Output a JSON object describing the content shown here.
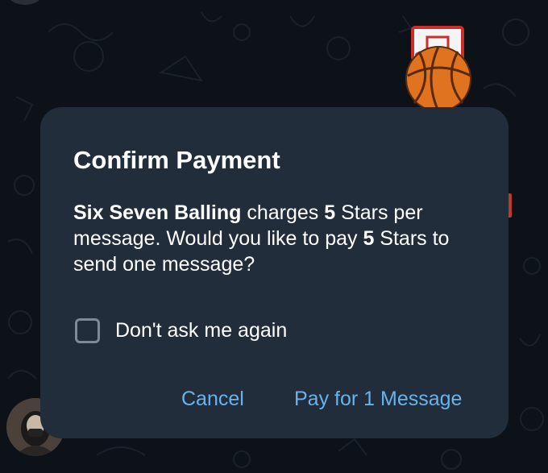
{
  "dialog": {
    "title": "Confirm Payment",
    "message": {
      "bot_name": "Six Seven Balling",
      "part1": " charges ",
      "stars_per_message": "5",
      "part2": " Stars per message. Would you like to pay ",
      "stars_to_pay": "5",
      "part3": " Stars to send one message?"
    },
    "checkbox": {
      "label": "Don't ask me again",
      "checked": false
    },
    "buttons": {
      "cancel": "Cancel",
      "confirm": "Pay for 1 Message"
    }
  },
  "colors": {
    "background": "#0c1218",
    "dialog_background": "#212d3b",
    "accent": "#68b3ec",
    "text": "#ffffff"
  },
  "icons": {
    "sticker": "basketball-hoop-sticker-icon",
    "checkbox": "checkbox-unchecked-icon"
  }
}
